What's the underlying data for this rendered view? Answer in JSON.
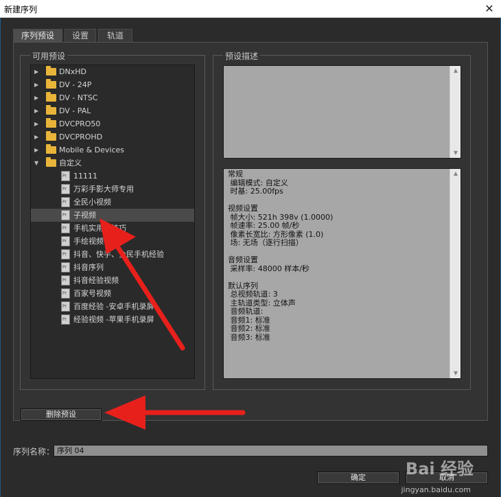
{
  "window": {
    "title": "新建序列",
    "close_glyph": "✕"
  },
  "tabs": [
    {
      "label": "序列预设",
      "active": true
    },
    {
      "label": "设置",
      "active": false
    },
    {
      "label": "轨道",
      "active": false
    }
  ],
  "available_presets": {
    "title": "可用预设",
    "items": [
      {
        "label": "DNxHD",
        "type": "folder",
        "expanded": false
      },
      {
        "label": "DV - 24P",
        "type": "folder",
        "expanded": false
      },
      {
        "label": "DV - NTSC",
        "type": "folder",
        "expanded": false
      },
      {
        "label": "DV - PAL",
        "type": "folder",
        "expanded": false
      },
      {
        "label": "DVCPRO50",
        "type": "folder",
        "expanded": false
      },
      {
        "label": "DVCPROHD",
        "type": "folder",
        "expanded": false
      },
      {
        "label": "Mobile & Devices",
        "type": "folder",
        "expanded": false
      },
      {
        "label": "自定义",
        "type": "folder",
        "expanded": true
      },
      {
        "label": "11111",
        "type": "preset"
      },
      {
        "label": "万彩手影大师专用",
        "type": "preset"
      },
      {
        "label": "全民小视频",
        "type": "preset"
      },
      {
        "label": "子视频",
        "type": "preset",
        "selected": true
      },
      {
        "label": "手机实用小技巧",
        "type": "preset"
      },
      {
        "label": "手绘视频",
        "type": "preset"
      },
      {
        "label": "抖音、快手、全民手机经验",
        "type": "preset"
      },
      {
        "label": "抖音序列",
        "type": "preset"
      },
      {
        "label": "抖音经验视频",
        "type": "preset"
      },
      {
        "label": "百家号视频",
        "type": "preset"
      },
      {
        "label": "百度经验 -安卓手机录屏",
        "type": "preset"
      },
      {
        "label": "经验视频 -苹果手机录屏",
        "type": "preset"
      }
    ]
  },
  "preset_description": {
    "title": "预设描述",
    "details": "常规\n 编辑模式: 自定义\n 时基: 25.00fps\n\n视频设置\n 帧大小: 521h 398v (1.0000)\n 帧速率: 25.00 帧/秒\n 像素长宽比: 方形像素 (1.0)\n 场: 无场（逐行扫描）\n\n音频设置\n 采样率: 48000 样本/秒\n\n默认序列\n 总视频轨道: 3\n 主轨道类型: 立体声\n 音频轨道:\n 音频1: 标准\n 音频2: 标准\n 音频3: 标准"
  },
  "buttons": {
    "delete_preset": "删除预设",
    "ok": "确定",
    "cancel": "取消"
  },
  "sequence_name": {
    "label": "序列名称：",
    "value": "序列 04"
  },
  "watermark": {
    "brand": "Bai 经验",
    "url": "jingyan.baidu.com"
  },
  "colors": {
    "arrow": "#e8201c",
    "folder": "#e8b43a",
    "panel_bg": "#333333"
  }
}
